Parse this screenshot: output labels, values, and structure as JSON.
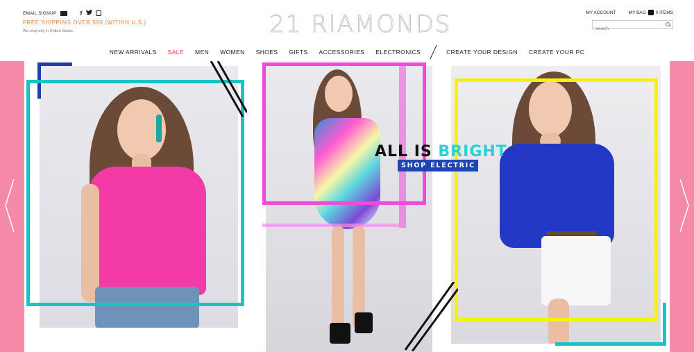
{
  "header": {
    "email_signup": "EMAIL SIGNUP",
    "shipping_promo": "FREE SHIPPING OVER $50 (WITHIN U.S.)",
    "ship_note": "We ship only in United States.",
    "logo": "21 RIAMONDS",
    "social_icons": [
      "facebook-icon",
      "twitter-icon",
      "instagram-icon"
    ],
    "my_account": "MY ACCOUNT",
    "my_bag": "MY BAG",
    "bag_count": "0 ITEMS",
    "search_placeholder": "Search"
  },
  "nav": {
    "items": [
      "NEW ARRIVALS",
      "SALE",
      "MEN",
      "WOMEN",
      "SHOES",
      "GIFTS",
      "ACCESSORIES",
      "ELECTRONICS"
    ],
    "extra_items": [
      "CREATE YOUR DESIGN",
      "CREATE YOUR PC"
    ],
    "highlight_color": "#e8413c"
  },
  "hero": {
    "headline_part1": "ALL IS ",
    "headline_part2": "BRIGHT",
    "cta": "SHOP ELECTRIC",
    "colors": {
      "pink_side": "#f58aa8",
      "cyan": "#19c3c6",
      "magenta": "#f24ad8",
      "yellow": "#f5f30c",
      "navy": "#1f3fa8",
      "cta_bg": "#1f44b5"
    }
  }
}
